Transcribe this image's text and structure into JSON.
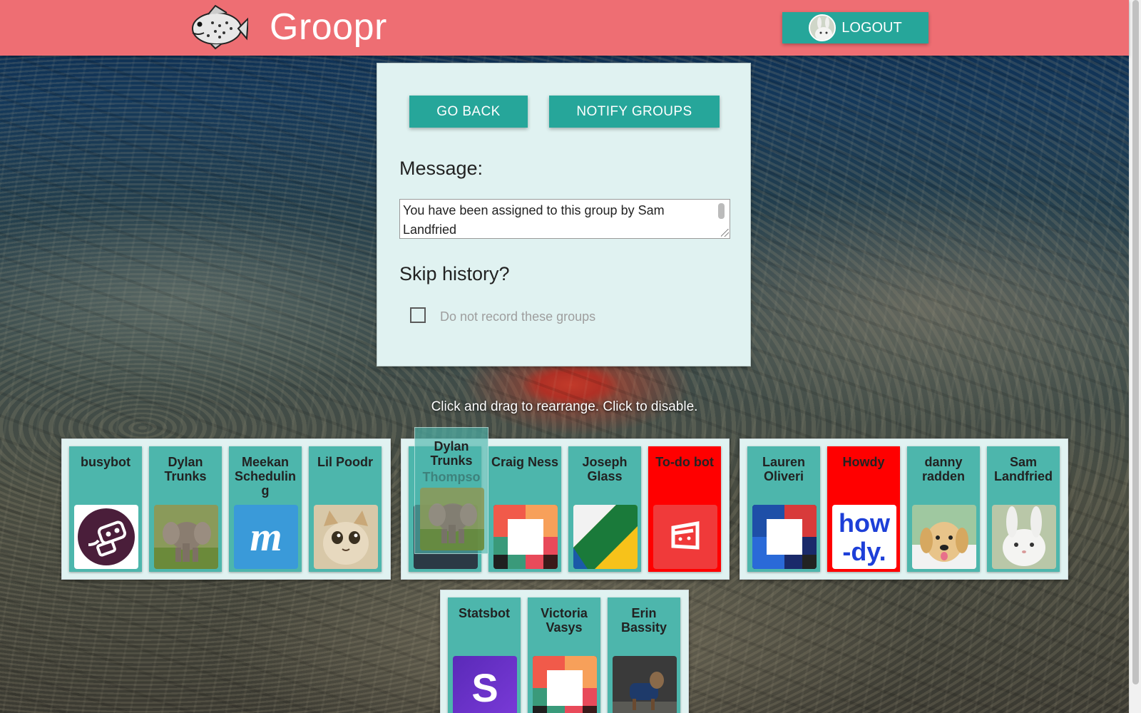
{
  "app": {
    "brand": "Groopr",
    "logout_label": "LOGOUT"
  },
  "panel": {
    "go_back_label": "GO BACK",
    "notify_label": "NOTIFY GROUPS",
    "message_label": "Message:",
    "message_value": "You have been assigned to this group by Sam Landfried",
    "skip_label": "Skip history?",
    "skip_checkbox_label": "Do not record these groups",
    "skip_checked": false
  },
  "hint": "Click and drag to rearrange. Click to disable.",
  "groups": [
    {
      "members": [
        {
          "name": "busybot",
          "icon": "busybot-robot-icon",
          "disabled": false
        },
        {
          "name": "Dylan Trunks",
          "icon": "elephant-photo",
          "disabled": false
        },
        {
          "name": "Meekan Schedulin g",
          "icon": "meekan-m-icon",
          "disabled": false
        },
        {
          "name": "Lil Poodr",
          "icon": "cat-photo",
          "disabled": false
        }
      ]
    },
    {
      "members": [
        {
          "name": "",
          "icon": "elephant-photo",
          "disabled": false
        },
        {
          "name": "Craig Ness",
          "icon": "slack-block-icon",
          "disabled": false
        },
        {
          "name": "Joseph Glass",
          "icon": "green-yellow-icon",
          "disabled": false
        },
        {
          "name": "To-do bot",
          "icon": "todo-bot-icon",
          "disabled": true
        }
      ]
    },
    {
      "members": [
        {
          "name": "Lauren Oliveri",
          "icon": "blue-block-icon",
          "disabled": false
        },
        {
          "name": "Howdy",
          "icon": "howdy-logo",
          "disabled": true
        },
        {
          "name": "danny radden",
          "icon": "puppy-photo",
          "disabled": false
        },
        {
          "name": "Sam Landfried",
          "icon": "bunny-photo",
          "disabled": false
        }
      ]
    },
    {
      "members": [
        {
          "name": "Statsbot",
          "icon": "statsbot-s-icon",
          "disabled": false
        },
        {
          "name": "Victoria Vasys",
          "icon": "slack-block-icon",
          "disabled": false
        },
        {
          "name": "Erin Bassity",
          "icon": "goat-photo",
          "disabled": false
        }
      ]
    }
  ],
  "drag_ghost": {
    "name": "Dylan Trunks",
    "overlapped_name": "Thompso",
    "icon": "elephant-photo"
  },
  "colors": {
    "header": "#ee6e73",
    "teal_button": "#26a69a",
    "card": "#4db6ac",
    "card_disabled": "#ff0000",
    "panel": "#e0f2f1"
  }
}
